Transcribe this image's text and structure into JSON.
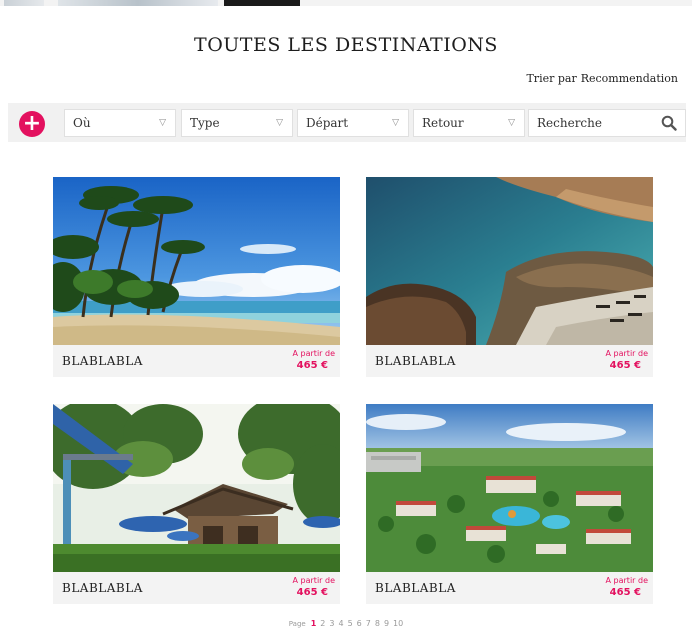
{
  "page": {
    "title": "TOUTES LES DESTINATIONS"
  },
  "sort": {
    "label": "Trier par",
    "value": "Recommendation"
  },
  "filters": {
    "add_icon": "plus-icon",
    "ou": "Où",
    "type": "Type",
    "depart": "Départ",
    "retour": "Retour",
    "search_placeholder": "Recherche",
    "search_icon": "search-icon",
    "chevron_icon": "chevron-down-icon"
  },
  "cards": [
    {
      "name": "BLABLABLA",
      "from_label": "A partir de",
      "price": "465 €",
      "image": "tropical-beach-palms"
    },
    {
      "name": "BLABLABLA",
      "from_label": "A partir de",
      "price": "465 €",
      "image": "rocky-coast-beach"
    },
    {
      "name": "BLABLABLA",
      "from_label": "A partir de",
      "price": "465 €",
      "image": "garden-bungalow"
    },
    {
      "name": "BLABLABLA",
      "from_label": "A partir de",
      "price": "465 €",
      "image": "resort-aerial"
    }
  ],
  "pagination": {
    "label": "Page",
    "pages": [
      "1",
      "2",
      "3",
      "4",
      "5",
      "6",
      "7",
      "8",
      "9",
      "10"
    ],
    "current": "1"
  },
  "colors": {
    "accent": "#e3115f",
    "bar": "#f1f1f1",
    "caption": "#f3f3f3"
  }
}
